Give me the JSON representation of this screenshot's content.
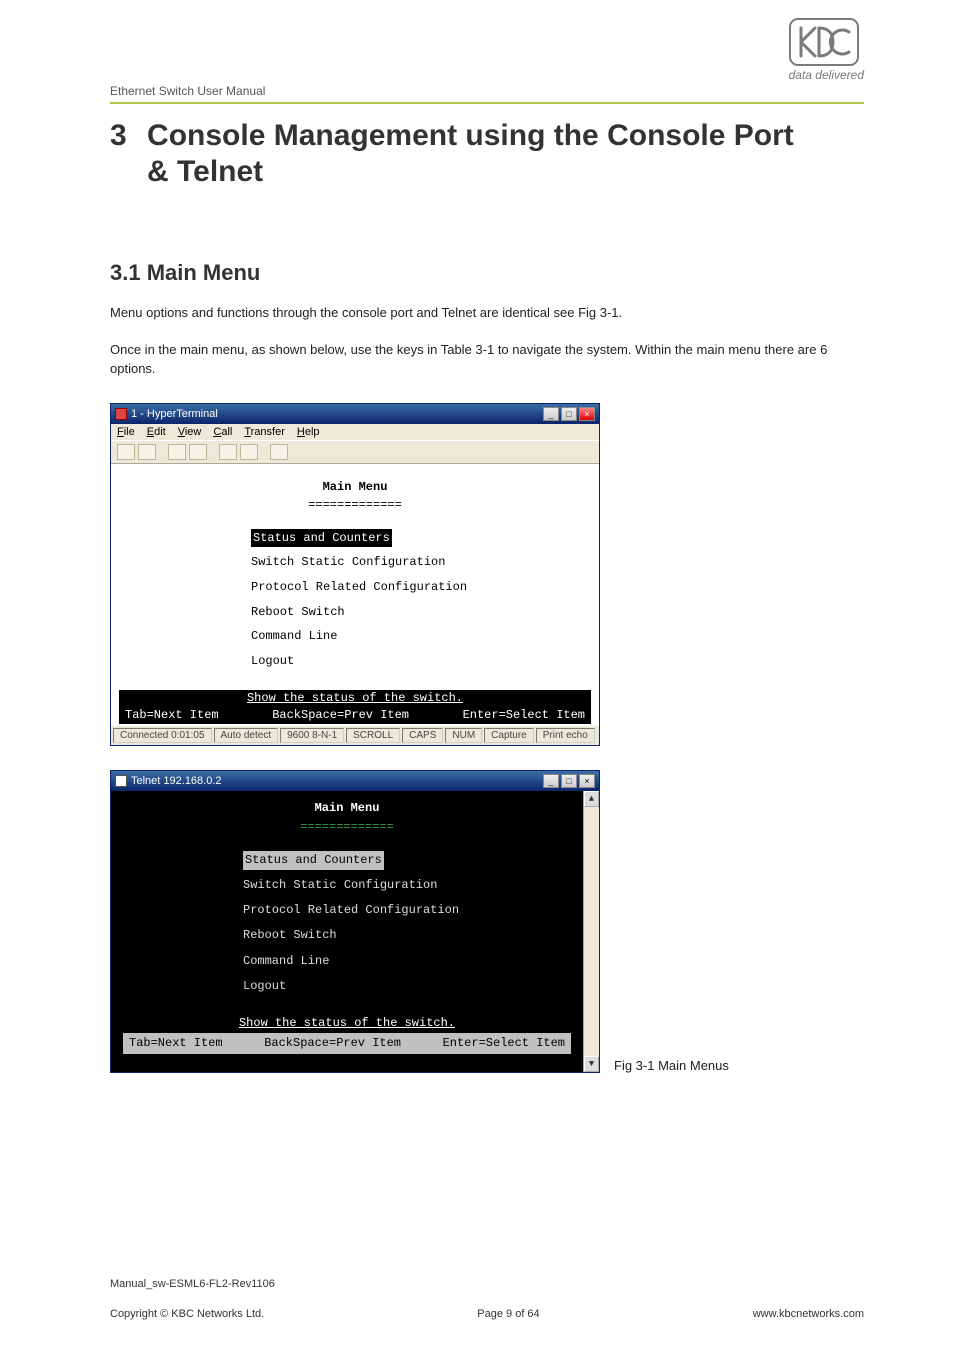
{
  "doc": {
    "header": "Ethernet Switch User Manual",
    "logo_tagline": "data delivered",
    "chapter_number": "3",
    "chapter_title": "Console Management using the Console Port & Telnet",
    "section_number_title": "3.1 Main Menu",
    "para1": "Menu options and functions through the console port and Telnet are identical see Fig 3-1.",
    "para2": "Once in the main menu, as shown below, use the keys in Table 3-1 to navigate the system.  Within the main menu there are 6 options.",
    "fig_caption": "Fig 3-1 Main Menus"
  },
  "hyper": {
    "window_title": "1 - HyperTerminal",
    "menu": {
      "file": "File",
      "edit": "Edit",
      "view": "View",
      "call": "Call",
      "transfer": "Transfer",
      "help": "Help"
    },
    "term_title": "Main Menu",
    "term_title_sep": "=============",
    "items": {
      "status": "Status and Counters",
      "static": "Switch Static Configuration",
      "proto": "Protocol Related Configuration",
      "reboot": "Reboot Switch",
      "cmd": "Command Line",
      "logout": "Logout"
    },
    "bar_top": "Show the status of the switch.",
    "bar": {
      "left": "Tab=Next Item",
      "center": "BackSpace=Prev Item",
      "right": "Enter=Select Item"
    },
    "status": {
      "conn": "Connected 0:01:05",
      "auto": "Auto detect",
      "baud": "9600 8-N-1",
      "scroll": "SCROLL",
      "caps": "CAPS",
      "num": "NUM",
      "capture": "Capture",
      "echo": "Print echo"
    }
  },
  "telnet": {
    "window_title": "Telnet 192.168.0.2",
    "term_title": "Main Menu",
    "term_title_sep": "=============",
    "items": {
      "status": "Status and Counters",
      "static": "Switch Static Configuration",
      "proto": "Protocol Related Configuration",
      "reboot": "Reboot Switch",
      "cmd": "Command Line",
      "logout": "Logout"
    },
    "bar_top": "Show the status of the switch.",
    "bar": {
      "left": "Tab=Next Item",
      "center": "BackSpace=Prev Item",
      "right": "Enter=Select Item"
    }
  },
  "footer": {
    "manual_id": "Manual_sw-ESML6-FL2-Rev1106",
    "copyright": "Copyright © KBC Networks Ltd.",
    "page": "Page 9 of 64",
    "url": "www.kbcnetworks.com"
  }
}
